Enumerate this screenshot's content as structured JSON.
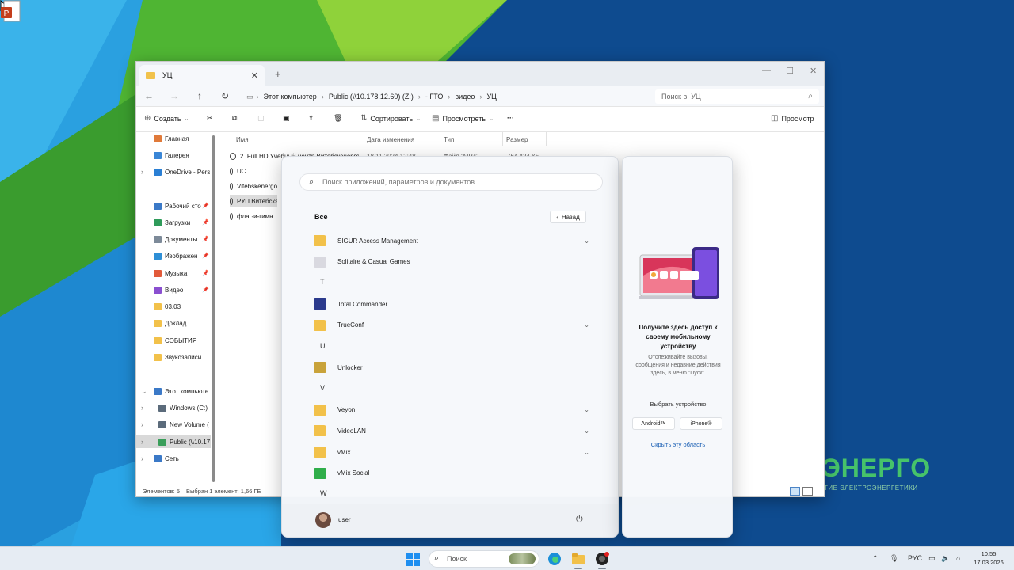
{
  "explorer": {
    "tab_title": "УЦ",
    "breadcrumbs": [
      "Этот компьютер",
      "Public (\\\\10.178.12.60) (Z:)",
      "- ГТО",
      "видео",
      "УЦ"
    ],
    "search_placeholder": "Поиск в: УЦ",
    "toolbar": {
      "create": "Создать",
      "sort": "Сортировать",
      "view": "Просмотреть",
      "more": "···",
      "preview": "Просмотр"
    },
    "nav": [
      {
        "label": "Главная",
        "color": "#e07a3a"
      },
      {
        "label": "Галерея",
        "color": "#3a86d6"
      },
      {
        "label": "OneDrive - Pers",
        "color": "#2a7fd4"
      },
      {
        "label": "Рабочий сто",
        "color": "#3b79c7"
      },
      {
        "label": "Загрузки",
        "color": "#2f9b5a"
      },
      {
        "label": "Документы",
        "color": "#7d8a99"
      },
      {
        "label": "Изображен",
        "color": "#2e8fd6"
      },
      {
        "label": "Музыка",
        "color": "#e25a3a"
      },
      {
        "label": "Видео",
        "color": "#8a4fd0"
      },
      {
        "label": "03.03",
        "color": "#f2c14a"
      },
      {
        "label": "Доклад",
        "color": "#f2c14a"
      },
      {
        "label": "СОБЫТИЯ",
        "color": "#f2c14a"
      },
      {
        "label": "Звукозаписи",
        "color": "#f2c14a"
      },
      {
        "label": "Этот компьюте",
        "color": "#3b79c7"
      },
      {
        "label": "Windows (C:)",
        "color": "#5b6b7b"
      },
      {
        "label": "New Volume (",
        "color": "#5b6b7b"
      },
      {
        "label": "Public (\\\\10.17",
        "color": "#3a9e5a"
      },
      {
        "label": "Сеть",
        "color": "#3b79c7"
      }
    ],
    "columns": [
      "Имя",
      "Дата изменения",
      "Тип",
      "Размер"
    ],
    "files": [
      {
        "name": "2. Full HD Учебный центр Витебскэнерго",
        "date": "18.11.2024 12:48",
        "type": "Файл \"MP4\"",
        "size": "764 424 КБ"
      },
      {
        "name": "UC",
        "date": "",
        "type": "",
        "size": ""
      },
      {
        "name": "Vitebskenergo",
        "date": "",
        "type": "",
        "size": ""
      },
      {
        "name": "РУП Витебскэ",
        "date": "",
        "type": "",
        "size": ""
      },
      {
        "name": "флаг-и-гимн",
        "date": "",
        "type": "",
        "size": ""
      }
    ],
    "status_count": "Элементов: 5",
    "status_selected": "Выбран 1 элемент: 1,66 ГБ"
  },
  "start_menu": {
    "search_placeholder": "Поиск приложений, параметров и документов",
    "all_label": "Все",
    "back_label": "Назад",
    "entries": [
      {
        "kind": "app",
        "label": "SIGUR Access Management",
        "icon": "folder-icon",
        "expand": true
      },
      {
        "kind": "app",
        "label": "Solitaire & Casual Games",
        "icon": "cards-icon",
        "expand": false
      },
      {
        "kind": "letter",
        "label": "T"
      },
      {
        "kind": "app",
        "label": "Total Commander",
        "icon": "floppy-icon",
        "expand": false
      },
      {
        "kind": "app",
        "label": "TrueConf",
        "icon": "folder-icon",
        "expand": true
      },
      {
        "kind": "letter",
        "label": "U"
      },
      {
        "kind": "app",
        "label": "Unlocker",
        "icon": "wand-icon",
        "expand": false
      },
      {
        "kind": "letter",
        "label": "V"
      },
      {
        "kind": "app",
        "label": "Veyon",
        "icon": "folder-icon",
        "expand": true
      },
      {
        "kind": "app",
        "label": "VideoLAN",
        "icon": "folder-icon",
        "expand": true
      },
      {
        "kind": "app",
        "label": "vMix",
        "icon": "folder-icon",
        "expand": true
      },
      {
        "kind": "app",
        "label": "vMix Social",
        "icon": "vmix-social-icon",
        "expand": false
      },
      {
        "kind": "letter",
        "label": "W"
      }
    ],
    "user": "user"
  },
  "phone_panel": {
    "title": "Получите здесь доступ к своему мобильному устройству",
    "description": "Отслеживайте вызовы, сообщения и недавние действия здесь, в меню \"Пуск\".",
    "choose_device": "Выбрать устройство",
    "android": "Android™",
    "iphone": "iPhone®",
    "hide": "Скрыть эту область"
  },
  "desktop": {
    "brand": "ЭНЕРГО",
    "brand_sub": "ТИЕ ЭЛЕКТРОЭНЕРГЕТИКИ"
  },
  "taskbar": {
    "search": "Поиск",
    "lang": "РУС",
    "time": "10:55",
    "date": "17.03.2026"
  }
}
